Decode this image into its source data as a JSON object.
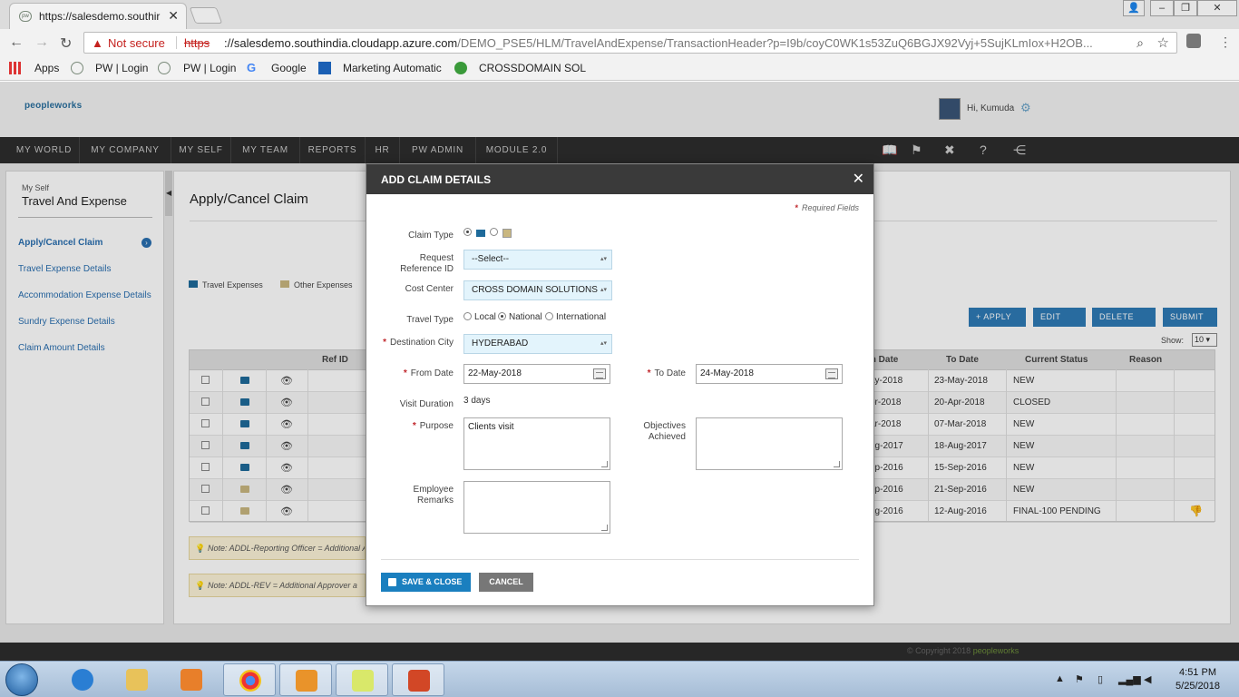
{
  "browser": {
    "tab_title": "https://salesdemo.southir",
    "security_label": "Not secure",
    "url_scheme": "https",
    "url_host": "://salesdemo.southindia.cloudapp.azure.com",
    "url_path": "/DEMO_PSE5/HLM/TravelAndExpense/TransactionHeader?p=I9b/coyC0WK1s53ZuQ6BGJX92Vyj+5SujKLmIox+H2OB...",
    "bookmarks": [
      "Apps",
      "PW | Login",
      "PW | Login",
      "Google",
      "Marketing Automatic",
      "CROSSDOMAIN SOL"
    ]
  },
  "app": {
    "logo": "peopleworks",
    "greeting": "Hi, Kumuda",
    "nav": [
      "MY WORLD",
      "MY COMPANY",
      "MY SELF",
      "MY TEAM",
      "REPORTS",
      "HR",
      "PW ADMIN",
      "MODULE 2.0"
    ],
    "sidebar": {
      "section": "My Self",
      "title": "Travel And Expense",
      "items": [
        "Apply/Cancel Claim",
        "Travel Expense Details",
        "Accommodation Expense Details",
        "Sundry Expense Details",
        "Claim Amount Details"
      ]
    },
    "page_title": "Apply/Cancel Claim",
    "expense_tabs": [
      "Travel Expenses",
      "Other Expenses"
    ],
    "actions": [
      "+ APPLY",
      "EDIT",
      "DELETE",
      "SUBMIT"
    ],
    "show_label": "Show:",
    "show_value": "10",
    "grid_headers": [
      "Ref ID",
      "m Date",
      "To Date",
      "Current Status",
      "Reason"
    ],
    "rows": [
      {
        "type": "travel",
        "from": "ay-2018",
        "to": "23-May-2018",
        "status": "NEW"
      },
      {
        "type": "travel",
        "from": "or-2018",
        "to": "20-Apr-2018",
        "status": "CLOSED"
      },
      {
        "type": "travel",
        "from": "ar-2018",
        "to": "07-Mar-2018",
        "status": "NEW"
      },
      {
        "type": "travel",
        "from": "ug-2017",
        "to": "18-Aug-2017",
        "status": "NEW"
      },
      {
        "type": "travel",
        "from": "ep-2016",
        "to": "15-Sep-2016",
        "status": "NEW"
      },
      {
        "type": "other",
        "from": "ep-2016",
        "to": "21-Sep-2016",
        "status": "NEW"
      },
      {
        "type": "other",
        "from": "ug-2016",
        "to": "12-Aug-2016",
        "status": "FINAL-100 PENDING"
      }
    ],
    "notes": [
      "Note: ADDL-Reporting Officer = Additional A",
      "Note: ADDL-REV = Additional Approver a"
    ],
    "copyright": "© Copyright 2018",
    "footer_logo": "peopleworks"
  },
  "modal": {
    "title": "ADD CLAIM DETAILS",
    "required_note": "Required Fields",
    "claim_type_label": "Claim Type",
    "request_ref_label": "Request Reference ID",
    "request_ref_value": "--Select--",
    "cost_center_label": "Cost Center",
    "cost_center_value": "CROSS DOMAIN SOLUTIONS",
    "travel_type_label": "Travel Type",
    "travel_types": [
      "Local",
      "National",
      "International"
    ],
    "destination_label": "Destination City",
    "destination_value": "HYDERABAD",
    "from_date_label": "From Date",
    "from_date_value": "22-May-2018",
    "to_date_label": "To Date",
    "to_date_value": "24-May-2018",
    "visit_duration_label": "Visit Duration",
    "visit_duration_value": "3 days",
    "purpose_label": "Purpose",
    "purpose_value": "Clients visit",
    "objectives_label": "Objectives Achieved",
    "remarks_label": "Employee Remarks",
    "save_label": "SAVE & CLOSE",
    "cancel_label": "CANCEL"
  },
  "taskbar": {
    "time": "4:51 PM",
    "date": "5/25/2018"
  }
}
